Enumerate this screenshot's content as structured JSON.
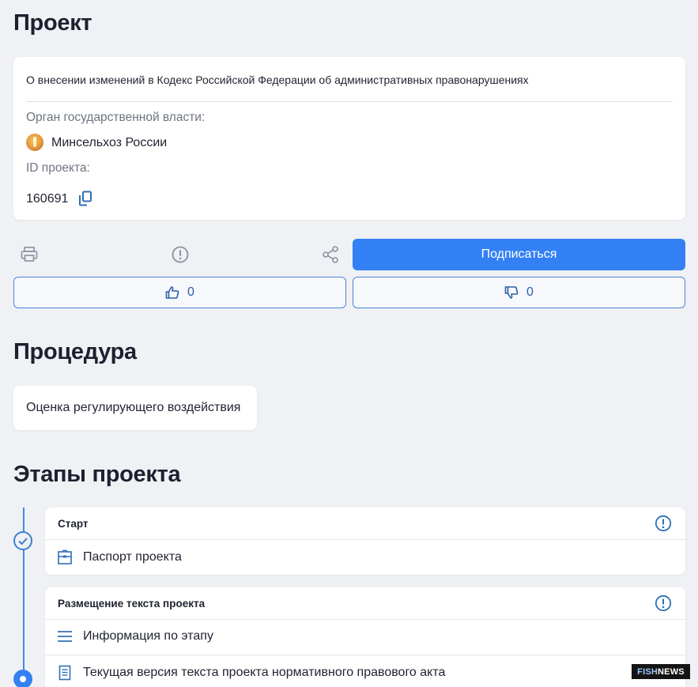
{
  "project": {
    "heading": "Проект",
    "title": "О внесении изменений в Кодекс Российской Федерации об административных правонарушениях",
    "authority_label": "Орган государственной власти:",
    "authority_value": "Минсельхоз России",
    "id_label": "ID проекта:",
    "id_value": "160691"
  },
  "actions": {
    "subscribe_label": "Подписаться",
    "likes": "0",
    "dislikes": "0"
  },
  "procedure": {
    "heading": "Процедура",
    "value": "Оценка регулирующего воздействия"
  },
  "stages": {
    "heading": "Этапы проекта",
    "items": [
      {
        "title": "Старт",
        "rows": [
          "Паспорт проекта"
        ]
      },
      {
        "title": "Размещение текста проекта",
        "rows": [
          "Информация по этапу",
          "Текущая версия текста проекта нормативного правового акта"
        ]
      }
    ]
  },
  "watermark": {
    "part1": "FISH",
    "part2": "NEWS"
  },
  "colors": {
    "accent": "#3380f5",
    "icon": "#2f6fb6",
    "background": "#eff1f4"
  }
}
